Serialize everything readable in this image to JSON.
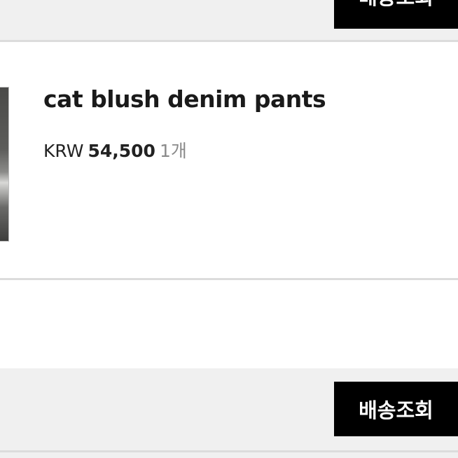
{
  "header": {
    "track_button_label": "배송조회"
  },
  "order_item": {
    "product_name": "cat blush denim pants",
    "currency": "KRW",
    "price": "54,500",
    "quantity": "1개"
  },
  "footer": {
    "track_button_label": "배송조회"
  },
  "colors": {
    "button_bg": "#000000",
    "button_text": "#ffffff",
    "page_bg": "#f0f0f0",
    "card_bg": "#ffffff",
    "quantity_text": "#8a8a8a"
  }
}
